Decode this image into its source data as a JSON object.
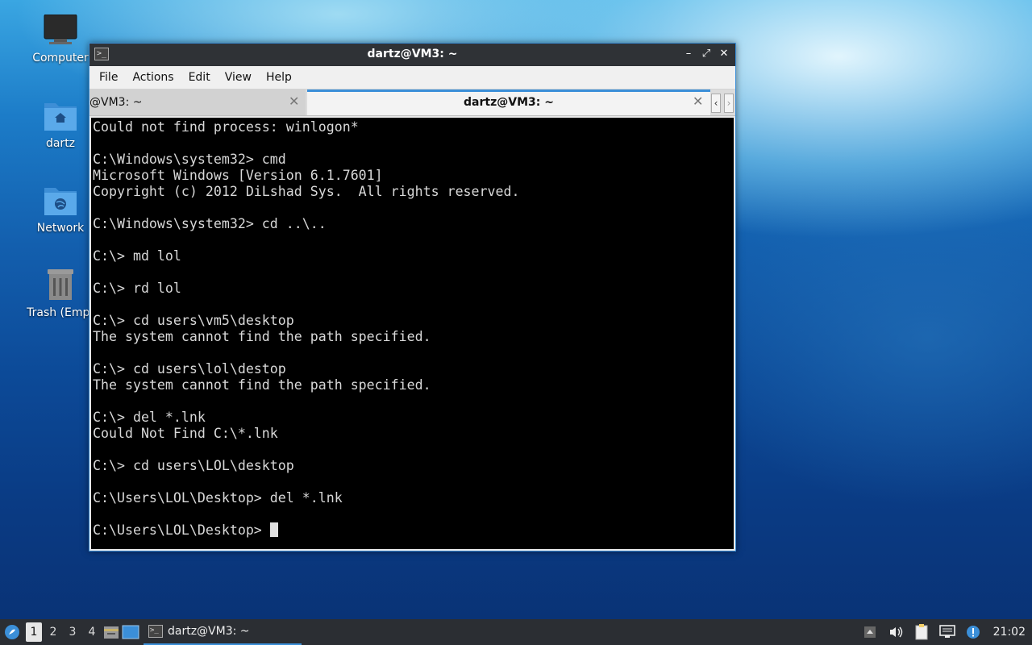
{
  "desktop": {
    "icons": [
      {
        "label": "Computer"
      },
      {
        "label": "dartz"
      },
      {
        "label": "Network"
      },
      {
        "label": "Trash (Empt"
      }
    ]
  },
  "window": {
    "title": "dartz@VM3: ~",
    "controls": {
      "minimize": "–",
      "maximize": "⤢",
      "close": "✕"
    },
    "menu": [
      "File",
      "Actions",
      "Edit",
      "View",
      "Help"
    ],
    "tabs": [
      {
        "label": "@VM3: ~",
        "close": "✕"
      },
      {
        "label": "dartz@VM3: ~",
        "close": "✕"
      }
    ],
    "tab_scroll": {
      "left": "‹",
      "right": "›"
    }
  },
  "terminal": {
    "lines": [
      "Could not find process: winlogon*",
      "",
      "C:\\Windows\\system32> cmd",
      "Microsoft Windows [Version 6.1.7601]",
      "Copyright (c) 2012 DiLshad Sys.  All rights reserved.",
      "",
      "C:\\Windows\\system32> cd ..\\..",
      "",
      "C:\\> md lol",
      "",
      "C:\\> rd lol",
      "",
      "C:\\> cd users\\vm5\\desktop",
      "The system cannot find the path specified.",
      "",
      "C:\\> cd users\\lol\\destop",
      "The system cannot find the path specified.",
      "",
      "C:\\> del *.lnk",
      "Could Not Find C:\\*.lnk",
      "",
      "C:\\> cd users\\LOL\\desktop",
      "",
      "C:\\Users\\LOL\\Desktop> del *.lnk",
      "",
      "C:\\Users\\LOL\\Desktop> "
    ]
  },
  "taskbar": {
    "workspaces": [
      "1",
      "2",
      "3",
      "4"
    ],
    "active_workspace": "1",
    "task_label": "dartz@VM3: ~",
    "clock": "21:02"
  },
  "colors": {
    "accent": "#3b8fd8",
    "terminal_bg": "#000000",
    "titlebar": "#2f3236"
  }
}
